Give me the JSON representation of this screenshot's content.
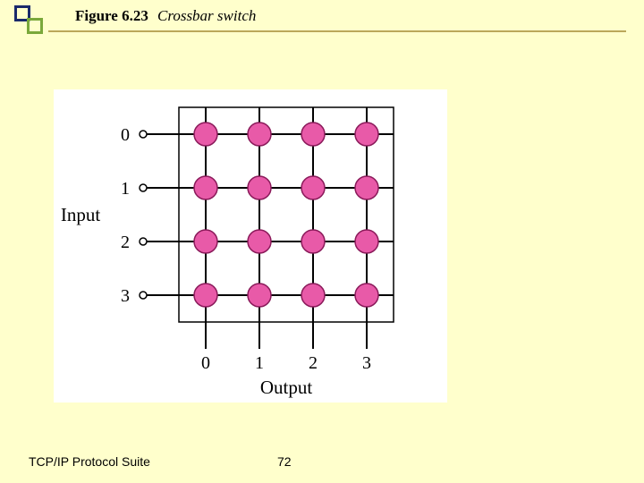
{
  "header": {
    "figure_label": "Figure 6.23",
    "caption": "Crossbar switch"
  },
  "diagram": {
    "input_label": "Input",
    "output_label": "Output",
    "input_ports": [
      "0",
      "1",
      "2",
      "3"
    ],
    "output_ports": [
      "0",
      "1",
      "2",
      "3"
    ]
  },
  "footer": {
    "left": "TCP/IP Protocol Suite",
    "page": "72"
  }
}
